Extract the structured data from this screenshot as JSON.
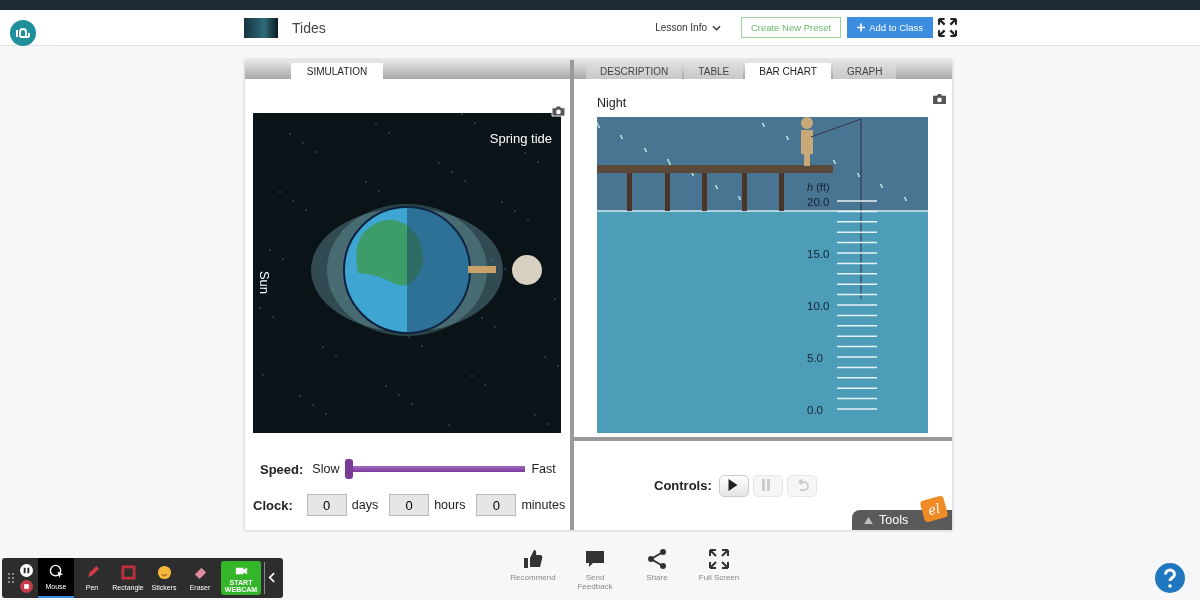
{
  "header": {
    "title": "Tides",
    "lesson_info": "Lesson Info",
    "buttons": [
      {
        "label": "Create New Preset",
        "kind": "outline"
      },
      {
        "label": "Add to Class",
        "kind": "primary"
      }
    ]
  },
  "left_tabs": [
    {
      "label": "SIMULATION",
      "selected": true
    }
  ],
  "right_tabs": [
    {
      "label": "DESCRIPTION",
      "selected": false
    },
    {
      "label": "TABLE",
      "selected": false
    },
    {
      "label": "BAR CHART",
      "selected": true
    },
    {
      "label": "GRAPH",
      "selected": false
    }
  ],
  "simulation": {
    "caption": "Spring tide",
    "sun_label": "Sun"
  },
  "speed": {
    "label": "Speed:",
    "min_label": "Slow",
    "max_label": "Fast",
    "level": 0
  },
  "clock": {
    "label": "Clock:",
    "fields": [
      {
        "value": "0",
        "unit": "days"
      },
      {
        "value": "0",
        "unit": "hours"
      },
      {
        "value": "0",
        "unit": "minutes"
      }
    ]
  },
  "scene": {
    "caption": "Night",
    "axis_label": "*h* (ft)",
    "ticks": [
      "20.0",
      "15.0",
      "10.0",
      "5.0",
      "0.0"
    ]
  },
  "controls": {
    "label": "Controls:",
    "buttons": [
      {
        "kind": "play",
        "disabled": false
      },
      {
        "kind": "pause",
        "disabled": true
      },
      {
        "kind": "reset",
        "disabled": true
      }
    ]
  },
  "tools": {
    "label": "Tools",
    "badge": "el"
  },
  "actions": [
    {
      "label": "Recommend",
      "kind": "thumb"
    },
    {
      "label": "Send Feedback",
      "kind": "chat"
    },
    {
      "label": "Share",
      "kind": "share"
    },
    {
      "label": "Full Screen",
      "kind": "expand"
    }
  ],
  "recorder": {
    "items": [
      {
        "label": "Mouse",
        "kind": "mouse",
        "selected": true
      },
      {
        "label": "Pen",
        "kind": "pen",
        "selected": false
      },
      {
        "label": "Rectangle",
        "kind": "rectangle",
        "selected": false
      },
      {
        "label": "Stickers",
        "kind": "stickers",
        "selected": false
      },
      {
        "label": "Eraser",
        "kind": "eraser",
        "selected": false
      },
      {
        "label": "START WEBCAM",
        "kind": "webcam",
        "selected": false
      }
    ]
  }
}
